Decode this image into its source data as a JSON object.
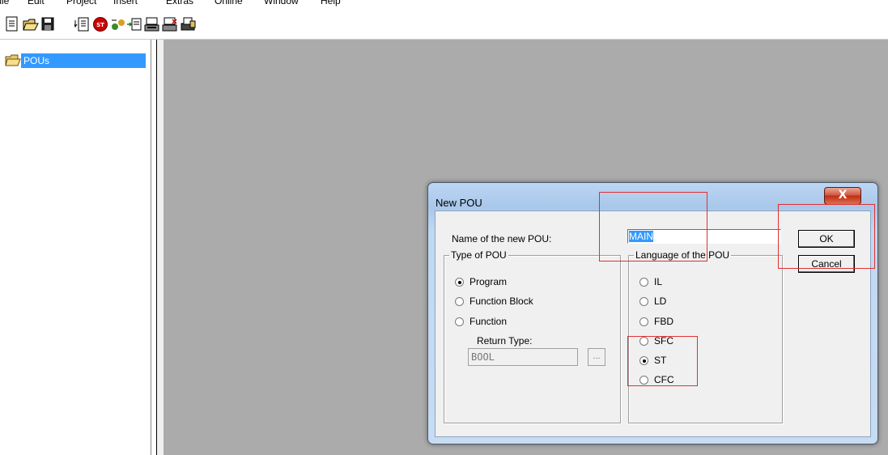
{
  "menu": {
    "items": [
      "File",
      "Edit",
      "Project",
      "Insert",
      "Extras",
      "Online",
      "Window",
      "Help"
    ]
  },
  "toolbar": {
    "buttons": [
      "new-icon",
      "open-icon",
      "save-icon",
      "login-icon",
      "stop-icon",
      "run-icon",
      "step-icon",
      "logout-icon",
      "logout-remove-icon",
      "print-icon"
    ]
  },
  "tree": {
    "root_label": "POUs"
  },
  "dialog": {
    "title": "New POU",
    "close_glyph": "X",
    "name_label": "Name of the new POU:",
    "name_value": "MAIN",
    "ok_label": "OK",
    "cancel_label": "Cancel",
    "type_group": {
      "title": "Type of POU",
      "options": [
        "Program",
        "Function Block",
        "Function"
      ],
      "selected": "Program",
      "return_type_label": "Return Type:",
      "return_type_value": "BOOL",
      "browse_label": "..."
    },
    "language_group": {
      "title": "Language of the POU",
      "options": [
        "IL",
        "LD",
        "FBD",
        "SFC",
        "ST",
        "CFC"
      ],
      "selected": "ST"
    }
  },
  "colors": {
    "workspace": "#ababab",
    "selection": "#3399ff",
    "highlight_box": "#e03030",
    "close_button": "#c7412b"
  }
}
